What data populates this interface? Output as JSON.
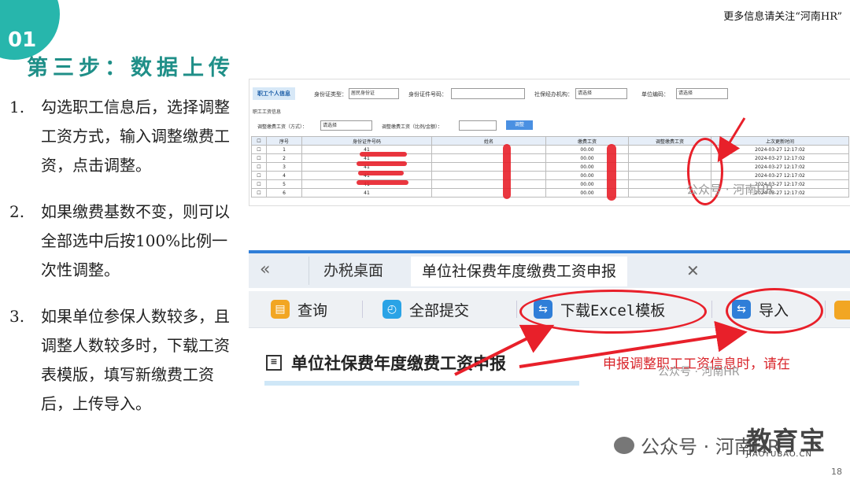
{
  "header": {
    "step_number": "01",
    "step_title": "第三步：数据上传",
    "top_watermark": "更多信息请关注“河南HR”"
  },
  "instructions": [
    {
      "num": "1.",
      "text": "勾选职工信息后，选择调整工资方式，输入调整缴费工资，点击调整。"
    },
    {
      "num": "2.",
      "text": "如果缴费基数不变，则可以全部选中后按100%比例一次性调整。"
    },
    {
      "num": "3.",
      "text": "如果单位参保人数较多，且调整人数较多时，下载工资表模版，填写新缴费工资后，上传导入。"
    }
  ],
  "screenshot_top": {
    "tab": "职工个人信息",
    "filters": {
      "id_type_label": "身份证类型：",
      "id_type_value": "居民身份证",
      "id_number_label": "身份证件号码：",
      "agency_label": "社保经办机构：",
      "agency_value": "请选择",
      "unit_code_label": "单位编码：",
      "unit_code_value": "请选择"
    },
    "section_label": "职工工资信息",
    "adjust_way_label": "调整缴费工资（方式）：",
    "adjust_way_value": "请选择",
    "adjust_amount_label": "调整缴费工资（比例/金额）：",
    "adjust_button": "调整",
    "columns": [
      "",
      "序号",
      "身份证件号码",
      "姓名",
      "缴费工资",
      "调整缴费工资",
      "上次更新时间"
    ],
    "rows": [
      {
        "no": "1",
        "id": "41",
        "salary": "00.00",
        "adjusted": "",
        "time": "2024-03-27 12:17:02"
      },
      {
        "no": "2",
        "id": "41",
        "salary": "00.00",
        "adjusted": "",
        "time": "2024-03-27 12:17:02"
      },
      {
        "no": "3",
        "id": "41",
        "salary": "00.00",
        "adjusted": "",
        "time": "2024-03-27 12:17:02"
      },
      {
        "no": "4",
        "id": "41",
        "salary": "00.00",
        "adjusted": "",
        "time": "2024-03-27 12:17:02"
      },
      {
        "no": "5",
        "id": "41",
        "salary": "00.00",
        "adjusted": "",
        "time": "2024-03-27 12:17:02"
      },
      {
        "no": "6",
        "id": "41",
        "salary": "00.00",
        "adjusted": "",
        "time": "2024-03-27 12:17:02"
      }
    ],
    "watermark": "公众号 · 河南HR"
  },
  "screenshot_bottom": {
    "back_icon": "«",
    "tab_desktop": "办税桌面",
    "tab_active": "单位社保费年度缴费工资申报",
    "tab_close": "✕",
    "toolbar": {
      "query": "查询",
      "submit_all": "全部提交",
      "download_template": "下载Excel模板",
      "import": "导入"
    },
    "heading": "单位社保费年度缴费工资申报",
    "notice": "申报调整职工工资信息时，请在",
    "watermark": "公众号 · 河南HR"
  },
  "footer": {
    "wechat_label": "公众号 · 河南HR",
    "brand": "教育宝",
    "brand_sub": "JIAOYUBAO.CN",
    "page_number": "18"
  },
  "colors": {
    "accent": "#27b6ac",
    "highlight_red": "#e8202a",
    "tab_blue": "#2f7ed8"
  }
}
